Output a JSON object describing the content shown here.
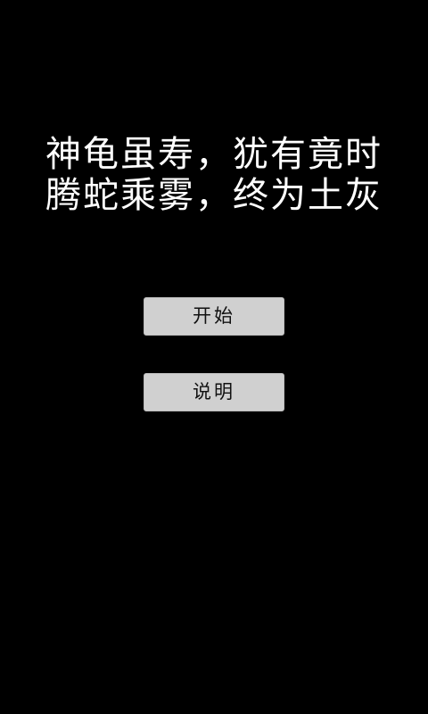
{
  "poem": {
    "line1": "神龟虽寿，犹有竟时",
    "line2": "腾蛇乘雾，终为土灰"
  },
  "menu": {
    "start_label": "开始",
    "help_label": "说明"
  },
  "colors": {
    "background": "#000000",
    "text": "#ffffff",
    "button_bg": "#d0d0d0",
    "button_text": "#111111"
  }
}
